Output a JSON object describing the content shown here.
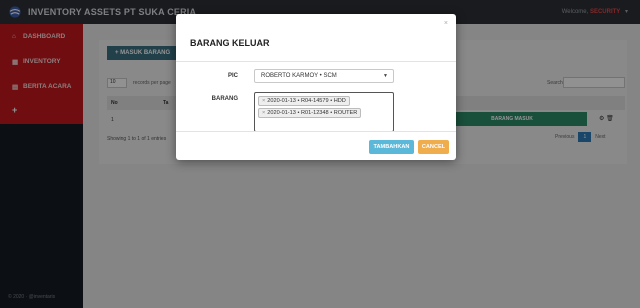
{
  "header": {
    "app_title": "INVENTORY ASSETS PT SUKA CERIA",
    "welcome_prefix": "Welcome,",
    "welcome_user": "SECURITY",
    "logo_icon": "globe-icon"
  },
  "sidebar": {
    "items": [
      {
        "label": "DASHBOARD",
        "icon": "home-icon"
      },
      {
        "label": "INVENTORY",
        "icon": "grid-icon"
      },
      {
        "label": "BERITA ACARA",
        "icon": "document-icon"
      }
    ],
    "plus": "+",
    "footer": "© 2020 · @inventaris"
  },
  "main": {
    "add_button": "+ MASUK BARANG",
    "length_value": "10",
    "length_label": "records per page",
    "search_label": "Search:",
    "table_headers": [
      "No",
      "Ta"
    ],
    "row": {
      "no": "1",
      "action": "BARANG MASUK"
    },
    "showing": "Showing 1 to 1 of 1 entries",
    "pager": {
      "prev": "Previous",
      "current": "1",
      "next": "Next"
    }
  },
  "modal": {
    "title": "BARANG KELUAR",
    "close": "×",
    "pic_label": "PIC",
    "pic_value": "ROBERTO KARMOY • SCM",
    "barang_label": "BARANG",
    "barang_tags": [
      "2020-01-13 • R04-14579 • HDD",
      "2020-01-13 • R01-12348 • ROUTER"
    ],
    "tambah_label": "TAMBAHKAN",
    "cancel_label": "CANCEL"
  },
  "colors": {
    "topbar": "#2b2f36",
    "sidebar_red": "#c2171c",
    "btn_info": "#5bb8d8",
    "btn_warning": "#f0ad4e",
    "table_green": "#2c8a66"
  }
}
